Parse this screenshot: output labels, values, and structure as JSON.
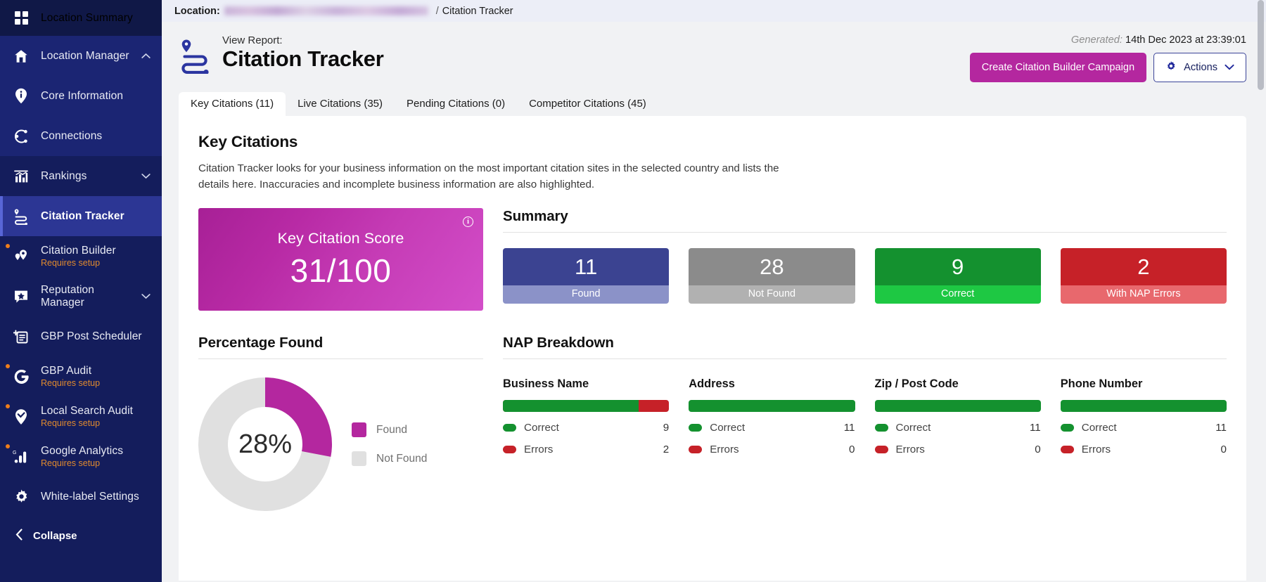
{
  "theme": {
    "sidebar_bg": "#141d5c",
    "sidebar_group_bg": "#1b2573",
    "sidebar_active_bg": "#2c3694",
    "accent_magenta": "#b4279f",
    "accent_navy": "#3b4498",
    "warn_orange": "#e08a2e",
    "green": "#14912f",
    "green_light": "#1ec843",
    "red": "#c62128",
    "red_light": "#e8686d",
    "grey": "#8b8b8b",
    "grey_light": "#b1b1b1",
    "blue": "#3b4391",
    "blue_light": "#8b92c8",
    "donut_found": "#b4279f",
    "donut_notfound": "#e0e0e0"
  },
  "sidebar": {
    "top_item": {
      "label": "Location Summary",
      "icon": "grid-icon"
    },
    "items": [
      {
        "label": "Location Manager",
        "icon": "home-icon",
        "chevron": "up",
        "group": true,
        "sub": null,
        "active": false,
        "dot": false
      },
      {
        "label": "Core Information",
        "icon": "info-pin-icon",
        "chevron": null,
        "group": true,
        "sub": null,
        "active": false,
        "dot": false
      },
      {
        "label": "Connections",
        "icon": "connections-icon",
        "chevron": null,
        "group": true,
        "sub": null,
        "active": false,
        "dot": false
      },
      {
        "label": "Rankings",
        "icon": "bar-chart-icon",
        "chevron": "down",
        "group": false,
        "sub": null,
        "active": false,
        "dot": false
      },
      {
        "label": "Citation Tracker",
        "icon": "citation-route-icon",
        "chevron": null,
        "group": false,
        "sub": null,
        "active": true,
        "dot": false
      },
      {
        "label": "Citation Builder",
        "icon": "double-pin-icon",
        "chevron": null,
        "group": false,
        "sub": "Requires setup",
        "active": false,
        "dot": true
      },
      {
        "label": "Reputation Manager",
        "icon": "star-speech-icon",
        "chevron": "down",
        "group": false,
        "sub": null,
        "active": false,
        "dot": false
      },
      {
        "label": "GBP Post Scheduler",
        "icon": "post-add-icon",
        "chevron": null,
        "group": false,
        "sub": null,
        "active": false,
        "dot": false
      },
      {
        "label": "GBP Audit",
        "icon": "google-g-icon",
        "chevron": null,
        "group": false,
        "sub": "Requires setup",
        "active": false,
        "dot": true
      },
      {
        "label": "Local Search Audit",
        "icon": "pin-check-icon",
        "chevron": null,
        "group": false,
        "sub": "Requires setup",
        "active": false,
        "dot": true
      },
      {
        "label": "Google Analytics",
        "icon": "google-analytics-icon",
        "chevron": null,
        "group": false,
        "sub": "Requires setup",
        "active": false,
        "dot": true
      },
      {
        "label": "White-label Settings",
        "icon": "gear-icon",
        "chevron": null,
        "group": false,
        "sub": null,
        "active": false,
        "dot": false
      }
    ],
    "collapse_label": "Collapse"
  },
  "breadcrumb": {
    "prefix": "Location:",
    "location_redacted": true,
    "separator": "/",
    "current": "Citation Tracker"
  },
  "header": {
    "kicker": "View Report:",
    "title": "Citation Tracker",
    "icon": "citation-route-icon",
    "generated_label": "Generated:",
    "generated_value": "14th Dec 2023 at 23:39:01",
    "primary_button": "Create Citation Builder Campaign",
    "actions_button": "Actions",
    "actions_icon": "gear-icon",
    "actions_chevron": "chevron-down-icon"
  },
  "tabs": [
    {
      "label": "Key Citations (11)",
      "active": true
    },
    {
      "label": "Live Citations (35)",
      "active": false
    },
    {
      "label": "Pending Citations (0)",
      "active": false
    },
    {
      "label": "Competitor Citations (45)",
      "active": false
    }
  ],
  "panel": {
    "heading": "Key Citations",
    "description": "Citation Tracker looks for your business information on the most important citation sites in the selected country and lists the details here. Inaccuracies and incomplete business information are also highlighted."
  },
  "score_card": {
    "label": "Key Citation Score",
    "value": "31/100",
    "info_icon": "info-icon"
  },
  "summary": {
    "heading": "Summary",
    "stats": [
      {
        "value": "11",
        "label": "Found",
        "top": "#3b4391",
        "bottom": "#8b92c8"
      },
      {
        "value": "28",
        "label": "Not Found",
        "top": "#8b8b8b",
        "bottom": "#b1b1b1"
      },
      {
        "value": "9",
        "label": "Correct",
        "top": "#14912f",
        "bottom": "#1ec843"
      },
      {
        "value": "2",
        "label": "With NAP Errors",
        "top": "#c62128",
        "bottom": "#e8686d"
      }
    ]
  },
  "percentage_found": {
    "heading": "Percentage Found",
    "center_label": "28%",
    "legend": [
      {
        "label": "Found",
        "color": "#b4279f"
      },
      {
        "label": "Not Found",
        "color": "#e0e0e0"
      }
    ]
  },
  "nap_breakdown": {
    "heading": "NAP Breakdown",
    "correct_label": "Correct",
    "errors_label": "Errors",
    "columns": [
      {
        "title": "Business Name",
        "correct": "9",
        "errors": "2",
        "correct_pct": 81.8
      },
      {
        "title": "Address",
        "correct": "11",
        "errors": "0",
        "correct_pct": 100
      },
      {
        "title": "Zip / Post Code",
        "correct": "11",
        "errors": "0",
        "correct_pct": 100
      },
      {
        "title": "Phone Number",
        "correct": "11",
        "errors": "0",
        "correct_pct": 100
      }
    ]
  },
  "chart_data": [
    {
      "type": "pie",
      "title": "Percentage Found",
      "labels": [
        "Found",
        "Not Found"
      ],
      "values": [
        28,
        72
      ],
      "colors": [
        "#b4279f",
        "#e0e0e0"
      ],
      "center_label": "28%",
      "donut": true,
      "legend_position": "right",
      "start_angle": 0
    },
    {
      "type": "bar",
      "title": "Summary",
      "categories": [
        "Found",
        "Not Found",
        "Correct",
        "With NAP Errors"
      ],
      "values": [
        11,
        28,
        9,
        2
      ],
      "xlabel": "",
      "ylabel": "",
      "grid": false
    },
    {
      "type": "bar",
      "title": "NAP Breakdown",
      "orientation": "horizontal",
      "stacked": true,
      "categories": [
        "Business Name",
        "Address",
        "Zip / Post Code",
        "Phone Number"
      ],
      "series": [
        {
          "name": "Correct",
          "values": [
            9,
            11,
            11,
            11
          ],
          "color": "#14912f"
        },
        {
          "name": "Errors",
          "values": [
            2,
            0,
            0,
            0
          ],
          "color": "#c62128"
        }
      ],
      "grid": false,
      "legend_position": "inline"
    }
  ]
}
